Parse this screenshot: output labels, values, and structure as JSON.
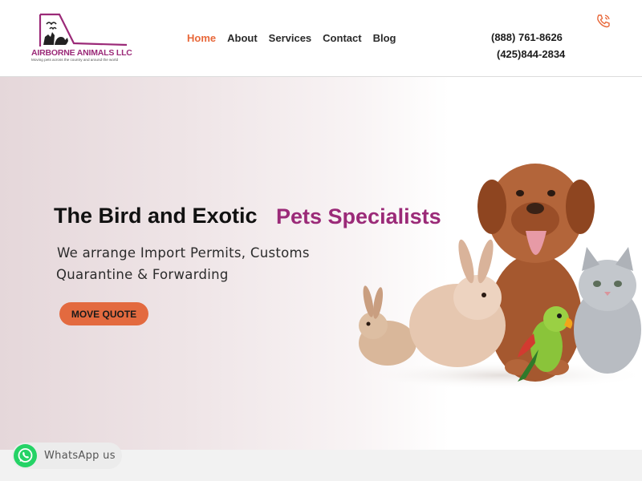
{
  "brand": {
    "name": "AIRBORNE ANIMALS LLC",
    "tagline": "Moving pets across the country and around the world",
    "colors": {
      "primary": "#9b2a78",
      "accent": "#e8683a"
    }
  },
  "nav": {
    "items": [
      {
        "label": "Home",
        "active": true
      },
      {
        "label": "About",
        "active": false
      },
      {
        "label": "Services",
        "active": false
      },
      {
        "label": "Contact",
        "active": false
      },
      {
        "label": "Blog",
        "active": false
      }
    ]
  },
  "contact": {
    "icon": "phone-icon",
    "phone_primary": "(888) 761-8626",
    "phone_secondary": "(425)844-2834"
  },
  "hero": {
    "title": "The Bird and Exotic",
    "title_accent": "Pets Specialists",
    "subtitle_line1": "We arrange Import Permits, Customs",
    "subtitle_line2": "Quarantine & Forwarding",
    "cta_label": "MOVE QUOTE",
    "image": "pets-group-image"
  },
  "whatsapp": {
    "label": "WhatsApp us",
    "icon": "whatsapp-icon",
    "color": "#25d366"
  }
}
